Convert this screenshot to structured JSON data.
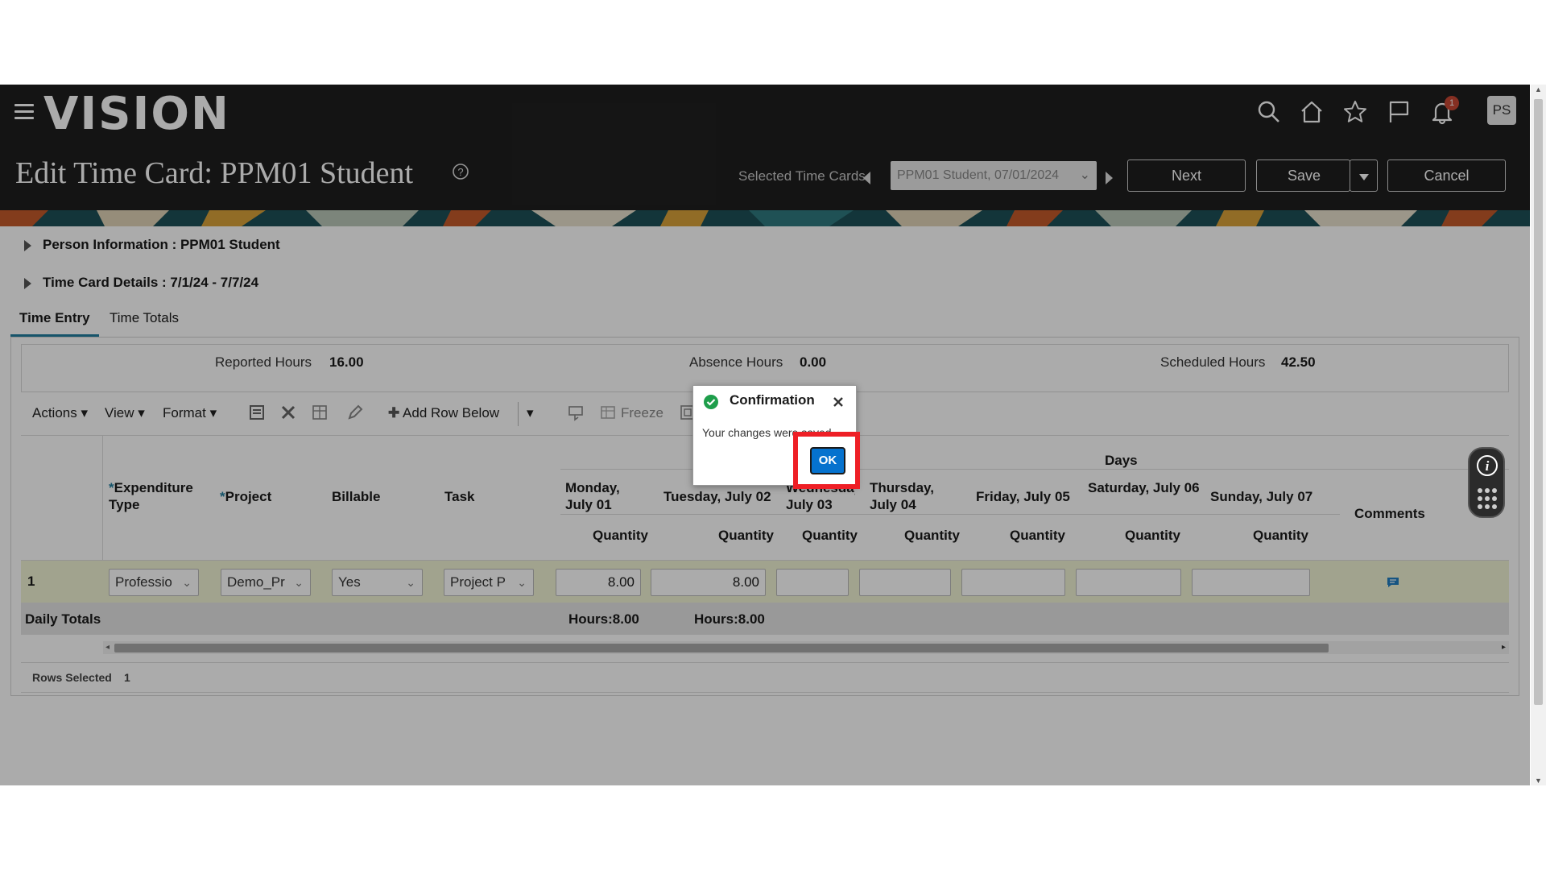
{
  "header": {
    "logo": "VISION",
    "title": "Edit Time Card: PPM01 Student",
    "selected_label": "Selected Time Cards",
    "selected_value": "PPM01 Student, 07/01/2024",
    "next_label": "Next",
    "save_label": "Save",
    "cancel_label": "Cancel",
    "avatar_initials": "PS",
    "notification_count": "1",
    "icons": [
      "hamburger-menu-icon",
      "search-icon",
      "home-icon",
      "star-icon",
      "flag-icon",
      "bell-icon",
      "help-icon"
    ]
  },
  "sections": {
    "person_info": "Person Information : PPM01 Student",
    "time_card_details": "Time Card Details : 7/1/24 - 7/7/24"
  },
  "tabs": [
    {
      "label": "Time Entry",
      "active": true
    },
    {
      "label": "Time Totals",
      "active": false
    }
  ],
  "summary": {
    "reported_label": "Reported Hours",
    "reported_value": "16.00",
    "absence_label": "Absence Hours",
    "absence_value": "0.00",
    "scheduled_label": "Scheduled Hours",
    "scheduled_value": "42.50"
  },
  "toolbar": {
    "actions": "Actions",
    "view": "View",
    "format": "Format",
    "add_row_below": "Add Row Below",
    "freeze": "Freeze"
  },
  "table": {
    "days_header": "Days",
    "columns": {
      "expenditure_type": "Expenditure Type",
      "project": "Project",
      "billable": "Billable",
      "task": "Task",
      "comments": "Comments"
    },
    "days": [
      "Monday, July 01",
      "Tuesday, July 02",
      "Wednesday, July 03",
      "Thursday, July 04",
      "Friday, July 05",
      "Saturday, July 06",
      "Sunday, July 07"
    ],
    "quantity_label": "Quantity",
    "row": {
      "number": "1",
      "expenditure_type": "Professio",
      "project": "Demo_Pr",
      "billable": "Yes",
      "task": "Project P",
      "quantities": [
        "8.00",
        "8.00",
        "",
        "",
        "",
        "",
        ""
      ]
    },
    "daily_totals_label": "Daily Totals",
    "daily_totals": [
      "Hours:8.00",
      "Hours:8.00"
    ],
    "rows_selected_label": "Rows Selected",
    "rows_selected_value": "1"
  },
  "dialog": {
    "title": "Confirmation",
    "message": "Your changes were saved.",
    "ok_label": "OK"
  },
  "colors": {
    "header_bg": "#1f1f1f",
    "accent": "#227e9e",
    "ok_button": "#0572ce",
    "highlight": "#ee1f26",
    "row_bg": "#f0f3d4",
    "success": "#1e9e4b"
  }
}
